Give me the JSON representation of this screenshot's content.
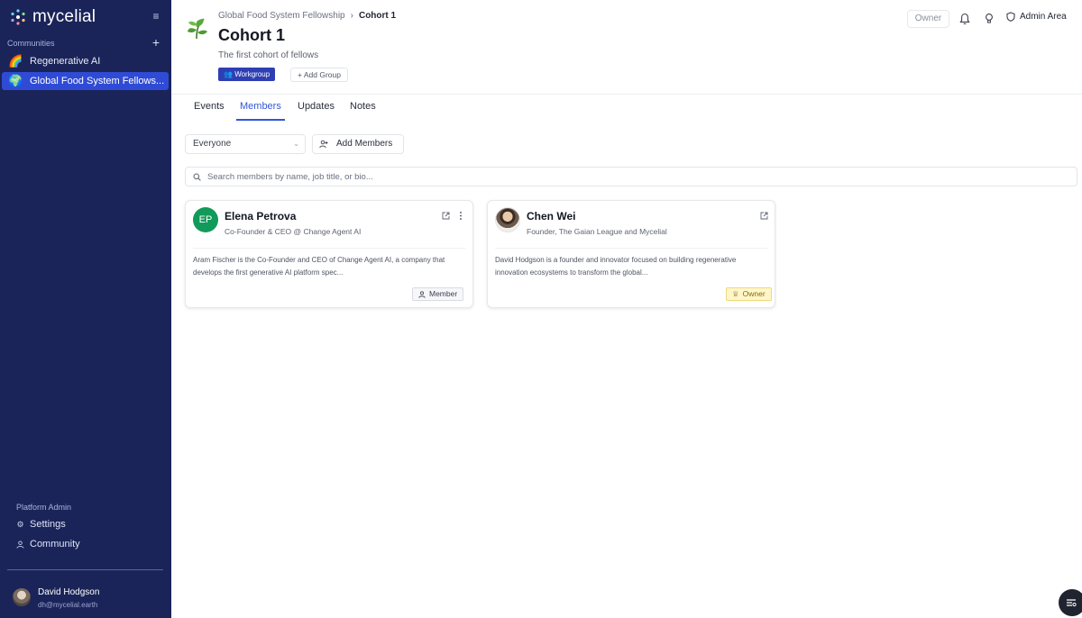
{
  "app": {
    "name": "mycelial"
  },
  "sidebar": {
    "section_label": "Communities",
    "communities": [
      {
        "label": "Regenerative AI",
        "emoji": "🌈",
        "active": false
      },
      {
        "label": "Global Food System Fellows...",
        "emoji": "🌍",
        "active": true
      }
    ],
    "admin_label": "Platform Admin",
    "admin_items": [
      {
        "label": "Settings",
        "icon": "gear-icon"
      },
      {
        "label": "Community",
        "icon": "person-icon"
      }
    ],
    "user": {
      "name": "David Hodgson",
      "email": "dh@mycelial.earth"
    }
  },
  "header": {
    "breadcrumb": {
      "parent": "Global Food System Fellowship",
      "separator": "›",
      "current": "Cohort 1"
    },
    "title": "Cohort 1",
    "subtitle": "The first cohort of fellows",
    "badge": "Workgroup",
    "add_group": "+ Add Group",
    "role": "Owner",
    "admin_area": "Admin Area"
  },
  "tabs": [
    {
      "label": "Events",
      "active": false
    },
    {
      "label": "Members",
      "active": true
    },
    {
      "label": "Updates",
      "active": false
    },
    {
      "label": "Notes",
      "active": false
    }
  ],
  "filters": {
    "select_value": "Everyone",
    "add_members": "Add Members",
    "search_placeholder": "Search members by name, job title, or bio..."
  },
  "members": [
    {
      "name": "Elena Petrova",
      "initials": "EP",
      "title": "Co-Founder & CEO @ Change Agent AI",
      "bio": "Aram Fischer is the Co-Founder and CEO of Change Agent AI, a company that develops the first generative AI platform spec...",
      "role": "Member"
    },
    {
      "name": "Chen Wei",
      "initials": "",
      "title": "Founder, The Gaian League and Mycelial",
      "bio": "David Hodgson is a founder and innovator focused on building regenerative innovation ecosystems to transform the global...",
      "role": "Owner"
    }
  ],
  "colors": {
    "sidebar_bg": "#1b2459",
    "accent": "#3156d8",
    "active_item": "#2f4bd6",
    "badge_bg": "#2d3fb3",
    "owner_badge_bg": "#fff6cc",
    "initials_avatar": "#119a5a"
  }
}
